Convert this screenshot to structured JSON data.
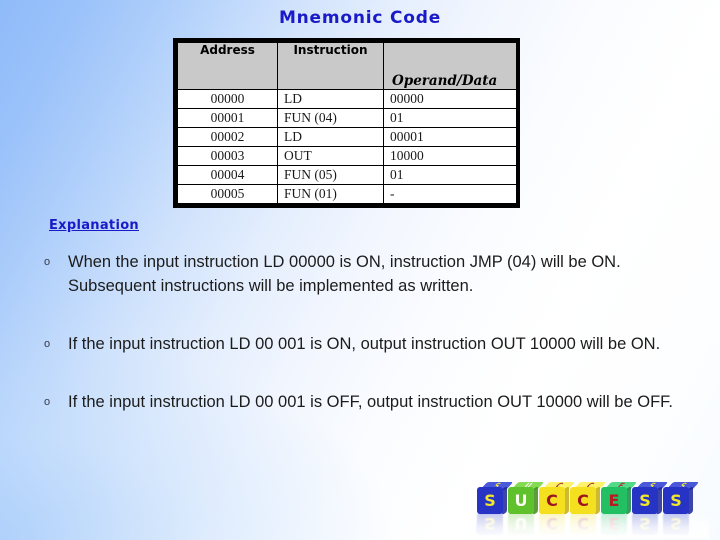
{
  "slide": {
    "title": "Mnemonic Code",
    "title_color": "#1a1ac8",
    "background_from": "#8fbbf9",
    "background_to": "#ffffff"
  },
  "table": {
    "headers": {
      "address": "Address",
      "instruction": "Instruction",
      "operand": "Operand/Data"
    },
    "header_fill": "#c9c9c9",
    "border_color": "#000000",
    "rows": [
      {
        "address": "00000",
        "instruction": "LD",
        "operand": "00000"
      },
      {
        "address": "00001",
        "instruction": "FUN (04)",
        "operand": "01"
      },
      {
        "address": "00002",
        "instruction": "LD",
        "operand": "00001"
      },
      {
        "address": "00003",
        "instruction": "OUT",
        "operand": "10000"
      },
      {
        "address": "00004",
        "instruction": "FUN (05)",
        "operand": "01"
      },
      {
        "address": "00005",
        "instruction": "FUN (01)",
        "operand": "-"
      }
    ]
  },
  "explanation": {
    "heading": "Explanation",
    "heading_color": "#1a1ac8",
    "bullet_marker": "o",
    "items": [
      {
        "text": "When the input instruction LD 00000 is ON, instruction JMP (04) will be ON. Subsequent instructions will be implemented as written."
      },
      {
        "text": "If the input instruction LD 00 001 is ON, output instruction OUT 10000 will be ON."
      },
      {
        "text": "If the input instruction LD 00 001 is OFF, output instruction OUT 10000 will be OFF."
      }
    ]
  },
  "success_graphic": {
    "word": "SUCCESS",
    "cubes": [
      {
        "letter": "S",
        "body": "#2633c4",
        "top": "#3b4ad8",
        "side": "#1b2496",
        "letter_color": "#f2e62a"
      },
      {
        "letter": "U",
        "body": "#5fc12c",
        "top": "#7ad845",
        "side": "#3f8c1c",
        "letter_color": "#fdfdf2"
      },
      {
        "letter": "C",
        "body": "#f5e020",
        "top": "#fdf15c",
        "side": "#c2ae10",
        "letter_color": "#9e1420"
      },
      {
        "letter": "C",
        "body": "#f5e020",
        "top": "#fdf15c",
        "side": "#c2ae10",
        "letter_color": "#9e1420"
      },
      {
        "letter": "E",
        "body": "#23bf63",
        "top": "#45d780",
        "side": "#178a45",
        "letter_color": "#b81b22"
      },
      {
        "letter": "S",
        "body": "#2633c4",
        "top": "#3b4ad8",
        "side": "#1b2496",
        "letter_color": "#f2e62a"
      },
      {
        "letter": "S",
        "body": "#2633c4",
        "top": "#3b4ad8",
        "side": "#1b2496",
        "letter_color": "#f2e62a"
      }
    ]
  }
}
